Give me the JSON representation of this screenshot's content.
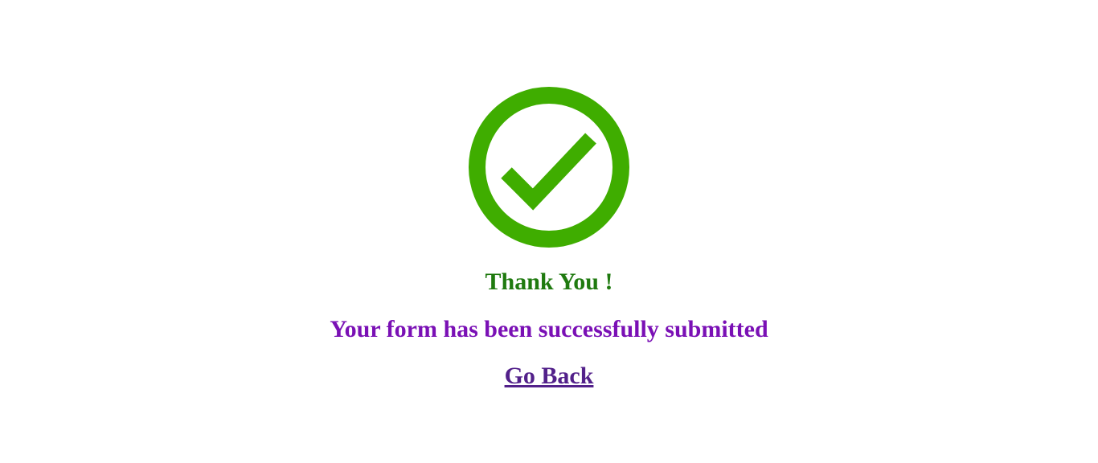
{
  "success": {
    "icon": "check-circle-icon",
    "color": "#3fad00"
  },
  "heading": {
    "text": "Thank You !",
    "color": "#1f7a0f"
  },
  "message": {
    "text": "Your form has been successfully submitted",
    "color": "#7a10b5"
  },
  "link": {
    "text": "Go Back",
    "color": "#52208a"
  }
}
